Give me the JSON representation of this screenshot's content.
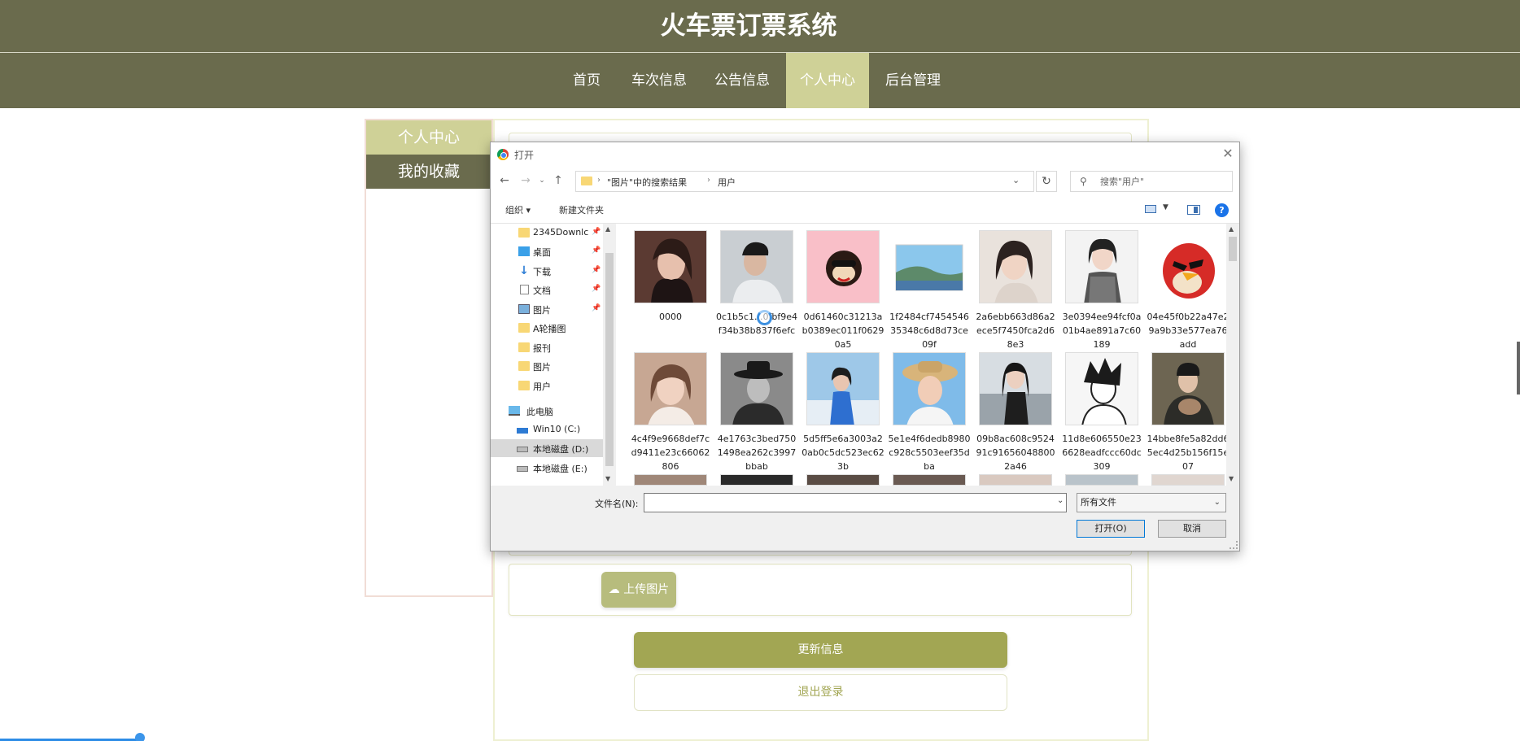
{
  "site": {
    "title": "火车票订票系统",
    "nav": [
      {
        "label": "首页",
        "active": false
      },
      {
        "label": "车次信息",
        "active": false
      },
      {
        "label": "公告信息",
        "active": false
      },
      {
        "label": "个人中心",
        "active": true
      },
      {
        "label": "后台管理",
        "active": false
      }
    ]
  },
  "sidebar": {
    "items": [
      {
        "label": "个人中心",
        "active": true
      },
      {
        "label": "我的收藏",
        "active": false
      }
    ]
  },
  "form": {
    "upload_label": "上传图片",
    "update_label": "更新信息",
    "logout_label": "退出登录"
  },
  "dialog": {
    "title": "打开",
    "address": {
      "segment1": "\"图片\"中的搜索结果",
      "segment2": "用户"
    },
    "search_placeholder": "搜索\"用户\"",
    "toolbar": {
      "organize": "组织 ▾",
      "new_folder": "新建文件夹",
      "help": "?"
    },
    "nav_items": [
      {
        "label": "2345Downlc",
        "icon": "folder-icon",
        "pinned": true,
        "selected": false
      },
      {
        "label": "桌面",
        "icon": "desktop-icon",
        "pinned": true,
        "selected": false
      },
      {
        "label": "下载",
        "icon": "download-icon",
        "pinned": true,
        "selected": false
      },
      {
        "label": "文档",
        "icon": "document-icon",
        "pinned": true,
        "selected": false
      },
      {
        "label": "图片",
        "icon": "pictures-icon",
        "pinned": true,
        "selected": false
      },
      {
        "label": "A轮播图",
        "icon": "folder-icon",
        "pinned": false,
        "selected": false
      },
      {
        "label": "报刊",
        "icon": "folder-icon",
        "pinned": false,
        "selected": false
      },
      {
        "label": "图片",
        "icon": "folder-icon",
        "pinned": false,
        "selected": false
      },
      {
        "label": "用户",
        "icon": "folder-icon",
        "pinned": false,
        "selected": false
      },
      {
        "label": "此电脑",
        "icon": "computer-icon",
        "pinned": false,
        "selected": false
      },
      {
        "label": "Win10 (C:)",
        "icon": "windows-drive-icon",
        "pinned": false,
        "selected": false
      },
      {
        "label": "本地磁盘 (D:)",
        "icon": "drive-icon",
        "pinned": false,
        "selected": true
      },
      {
        "label": "本地磁盘 (E:)",
        "icon": "drive-icon",
        "pinned": false,
        "selected": false
      }
    ],
    "files": [
      {
        "name": "0000",
        "thumb": "portrait-woman-icon"
      },
      {
        "name": "0c1b5c1...0fbf9e4f34b38b837f6efc",
        "thumb": "portrait-man-icon"
      },
      {
        "name": "0d61460c31213ab0389ec011f06290a5",
        "thumb": "monkey-cartoon-icon"
      },
      {
        "name": "1f2484cf745454635348c6d8d73ce09f",
        "thumb": "landscape-icon"
      },
      {
        "name": "2a6ebb663d86a2ece5f7450fca2d68e3",
        "thumb": "portrait-woman-icon"
      },
      {
        "name": "3e0394ee94fcf0a01b4ae891a7c60189",
        "thumb": "portrait-woman-icon"
      },
      {
        "name": "04e45f0b22a47e29a9b33e577ea76add",
        "thumb": "angry-bird-icon"
      },
      {
        "name": "4c4f9e9668def7cd9411e23c66062806",
        "thumb": "portrait-woman-icon"
      },
      {
        "name": "4e1763c3bed7501498ea262c3997bbab",
        "thumb": "portrait-man-hat-icon"
      },
      {
        "name": "5d5ff5e6a3003a20ab0c5dc523ec623b",
        "thumb": "portrait-woman-icon"
      },
      {
        "name": "5e1e4f6dedb8980c928c5503eef35dba",
        "thumb": "portrait-woman-hat-icon"
      },
      {
        "name": "09b8ac608c952491c916560488002a46",
        "thumb": "portrait-woman-icon"
      },
      {
        "name": "11d8e606550e236628eadfccc60dc309",
        "thumb": "anime-sketch-icon"
      },
      {
        "name": "14bbe8fe5a82dd65ec4d25b156f15e07",
        "thumb": "portrait-man-icon"
      }
    ],
    "filename_label": "文件名(N):",
    "filename_value": "",
    "filetype": "所有文件",
    "open_label": "打开(O)",
    "cancel_label": "取消"
  },
  "colors": {
    "header": "#6a6b4d",
    "accent": "#cfd197",
    "button": "#a2a653"
  }
}
